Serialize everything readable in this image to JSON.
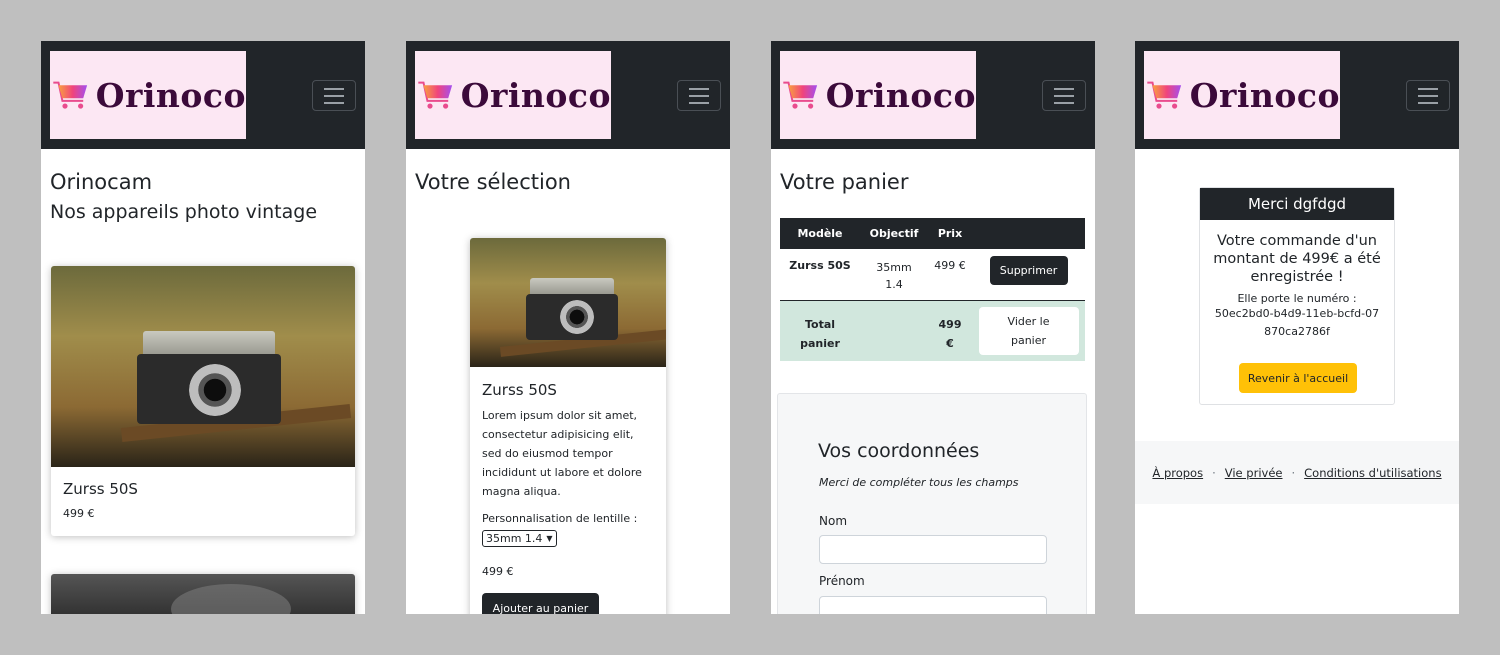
{
  "brand": {
    "name": "Orinoco"
  },
  "colors": {
    "navbar": "#212529",
    "logo_bg": "#fce7f3",
    "accent_warning": "#ffc107",
    "cart_total_row": "#d1e7dd"
  },
  "icons": {
    "logo": "cart-icon",
    "menu": "hamburger-menu-icon"
  },
  "screen1": {
    "title": "Orinocam",
    "subtitle": "Nos appareils photo vintage",
    "product": {
      "name": "Zurss 50S",
      "price": "499 €"
    }
  },
  "screen2": {
    "title": "Votre sélection",
    "product": {
      "name": "Zurss 50S",
      "description": "Lorem ipsum dolor sit amet, consectetur adipisicing elit, sed do eiusmod tempor incididunt ut labore et dolore magna aliqua.",
      "lens_label": "Personnalisation de lentille :",
      "lens_selected": "35mm 1.4",
      "price": "499 €",
      "add_button": "Ajouter au panier"
    }
  },
  "screen3": {
    "title": "Votre panier",
    "table": {
      "headers": [
        "Modèle",
        "Objectif",
        "Prix"
      ],
      "row": {
        "model": "Zurss 50S",
        "lens": "35mm 1.4",
        "price": "499 €",
        "remove_button": "Supprimer"
      },
      "total": {
        "label": "Total panier",
        "value": "499 €",
        "clear_button": "Vider le panier"
      }
    },
    "form": {
      "title": "Vos coordonnées",
      "hint": "Merci de compléter tous les champs",
      "name_label": "Nom",
      "firstname_label": "Prénom"
    }
  },
  "screen4": {
    "card_header": "Merci dgfdgd",
    "message": "Votre commande d'un montant de 499€ a été enregistrée !",
    "order_label": "Elle porte le numéro :",
    "order_number": "50ec2bd0-b4d9-11eb-bcfd-07870ca2786f",
    "home_button": "Revenir à l'accueil",
    "footer": {
      "about": "À propos",
      "privacy": "Vie privée",
      "terms": "Conditions d'utilisations",
      "separator": "·"
    }
  }
}
